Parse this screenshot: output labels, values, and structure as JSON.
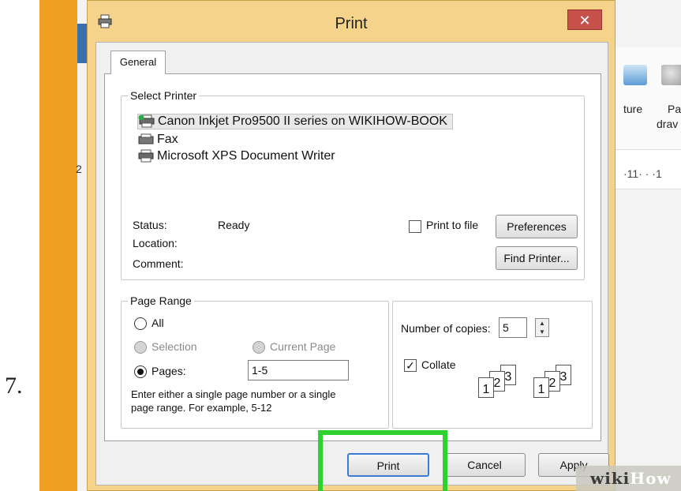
{
  "step_number": "7.",
  "background_app": {
    "ribbon_items": [
      "ture",
      "Pai",
      "drav"
    ],
    "line_number": "2",
    "ruler_text": "·11· · ·1"
  },
  "dialog": {
    "title": "Print",
    "close_label": "✕",
    "tab_general": "General",
    "select_printer": {
      "title": "Select Printer",
      "printers": [
        "Canon Inkjet Pro9500 II series on WIKIHOW-BOOK",
        "Fax",
        "Microsoft XPS Document Writer"
      ],
      "selected_index": 0
    },
    "status_label": "Status:",
    "status_value": "Ready",
    "location_label": "Location:",
    "comment_label": "Comment:",
    "print_to_file_label": "Print to file",
    "print_to_file_checked": false,
    "preferences_label": "Preferences",
    "find_printer_label": "Find Printer...",
    "page_range": {
      "title": "Page Range",
      "all_label": "All",
      "selection_label": "Selection",
      "current_page_label": "Current Page",
      "pages_label": "Pages:",
      "pages_value": "1-5",
      "selected": "Pages",
      "help_text_1": "Enter either a single page number or a single",
      "help_text_2": "page range.  For example, 5-12"
    },
    "copies": {
      "label": "Number of copies:",
      "value": "5",
      "collate_label": "Collate",
      "collate_checked": true,
      "collate_icon_pages": [
        "1",
        "2",
        "3",
        "1",
        "2",
        "3"
      ]
    },
    "buttons": {
      "print": "Print",
      "cancel": "Cancel",
      "apply": "Apply"
    }
  },
  "highlight_color": "#2ed12e",
  "watermark": {
    "part1": "wiki",
    "part2": "How"
  }
}
